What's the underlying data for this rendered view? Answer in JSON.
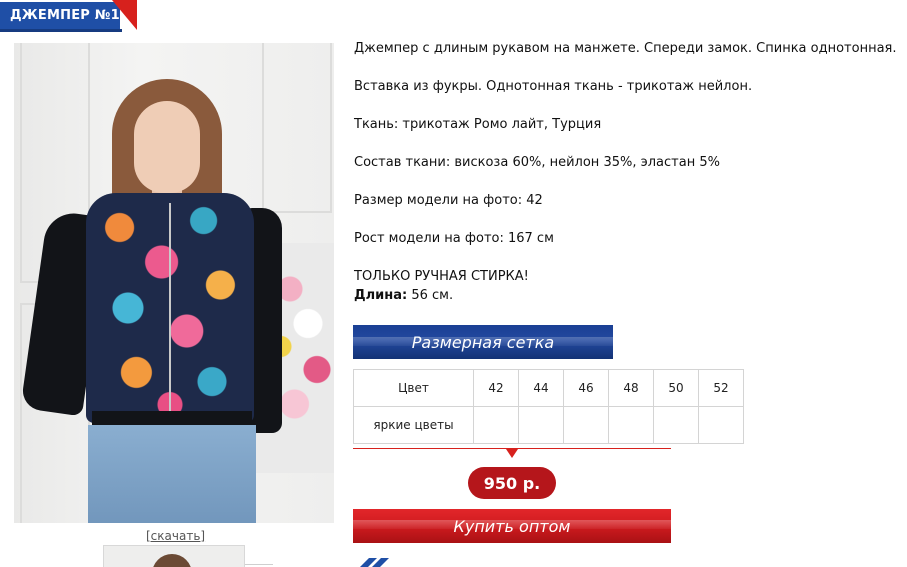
{
  "product": {
    "title": "ДЖЕМПЕР №1",
    "download_label": "[скачать]",
    "description": [
      "Джемпер с длиным рукавом на манжете. Спереди замок. Спинка однотонная.",
      "Вставка из фукры. Однотонная ткань - трикотаж нейлон.",
      "Ткань: трикотаж Ромо лайт, Турция",
      "Состав ткани: вискоза 60%, нейлон 35%, эластан 5%",
      "Размер модели на фото: 42",
      "Рост модели на фото: 167 см",
      "ТОЛЬКО РУЧНАЯ СТИРКА!"
    ],
    "length_label": "Длина:",
    "length_value": "56 см.",
    "size_chart_button": "Размерная сетка",
    "table": {
      "color_header": "Цвет",
      "sizes": [
        "42",
        "44",
        "46",
        "48",
        "50",
        "52"
      ],
      "rows": [
        {
          "color": "яркие цветы",
          "cells": [
            "",
            "",
            "",
            "",
            "",
            ""
          ]
        }
      ]
    },
    "price": "950 р.",
    "buy_button": "Купить оптом"
  },
  "colors": {
    "brand_blue": "#1f4fa6",
    "brand_red": "#d7211d",
    "price_red": "#b5161b"
  }
}
